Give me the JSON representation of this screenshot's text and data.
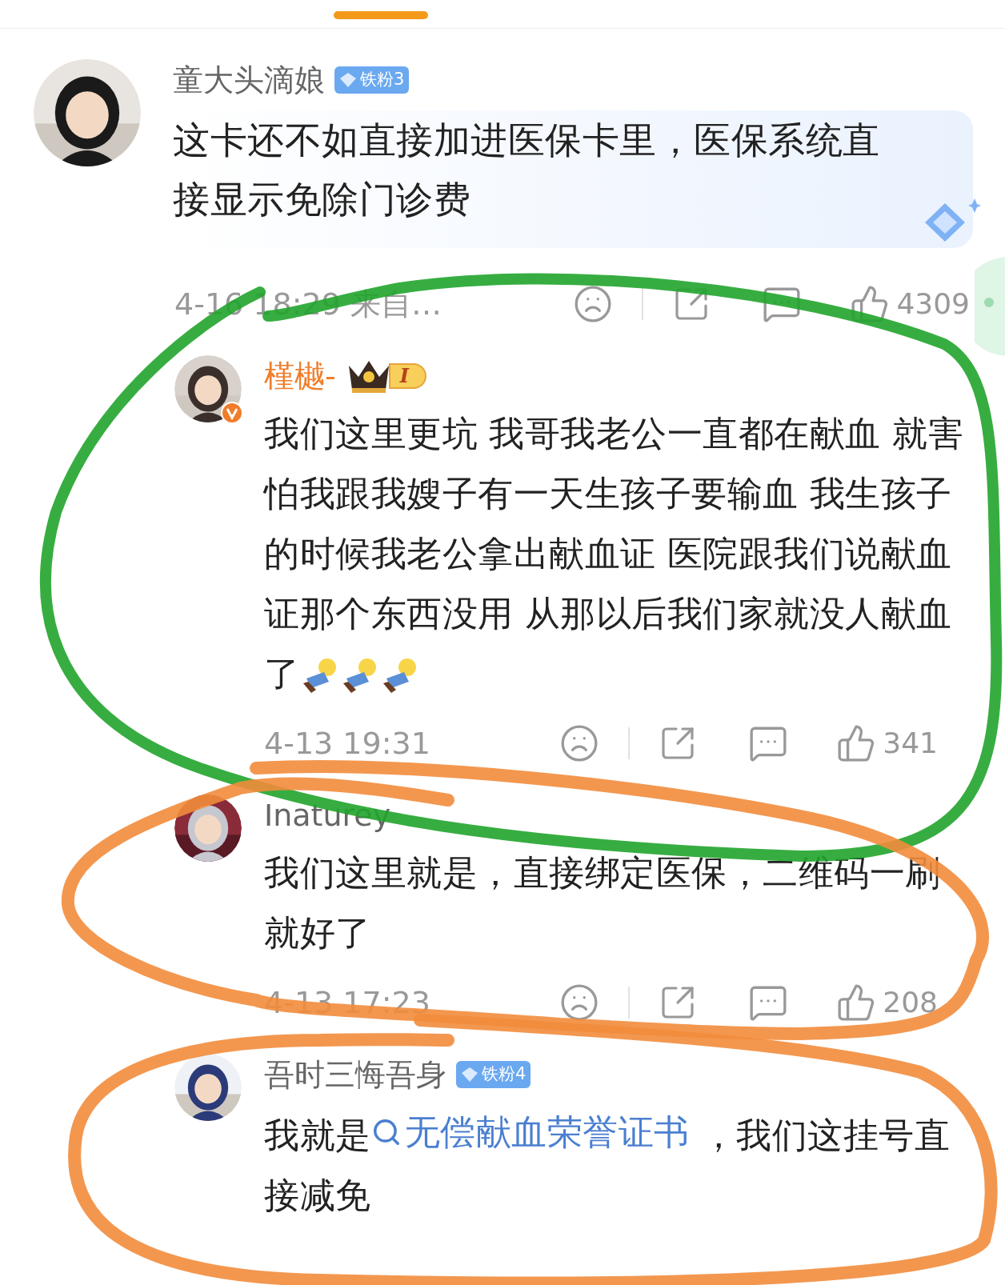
{
  "comment": {
    "user": "童大头滴娘",
    "badge": {
      "kind": "fan",
      "label": "铁粉3"
    },
    "highlighted": true,
    "body": [
      {
        "kind": "text",
        "text": "这卡还不如直接加进医保卡里，医保系统直接显示免除门诊费"
      }
    ],
    "time": "4-16 18:29 来自…",
    "likes": "4309"
  },
  "replies": [
    {
      "user": "槿樾-",
      "vip": true,
      "verified": true,
      "badge": {
        "kind": "crown",
        "label": "I"
      },
      "body": [
        {
          "kind": "text",
          "text": "我们这里更坑 我哥我老公一直都在献血 就害怕我跟我嫂子有一天生孩子要输血 我生孩子的时候我老公拿出献血证 医院跟我们说献血证那个东西没用 从那以后我们家就没人献血了"
        },
        {
          "kind": "emoticon"
        },
        {
          "kind": "emoticon"
        },
        {
          "kind": "emoticon"
        }
      ],
      "time": "4-13 19:31",
      "likes": "341"
    },
    {
      "user": "Inaturey",
      "vip": false,
      "body": [
        {
          "kind": "text",
          "text": "我们这里就是，直接绑定医保，二维码一刷就好了"
        }
      ],
      "time": "4-13 17:23",
      "likes": "208"
    },
    {
      "user": "吾时三悔吾身",
      "vip": false,
      "badge": {
        "kind": "fan",
        "label": "铁粉4"
      },
      "body": [
        {
          "kind": "text",
          "text": "我就是"
        },
        {
          "kind": "topic",
          "text": "无偿献血荣誉证书"
        },
        {
          "kind": "text",
          "text": " ，我们这挂号直接减免"
        }
      ]
    }
  ]
}
